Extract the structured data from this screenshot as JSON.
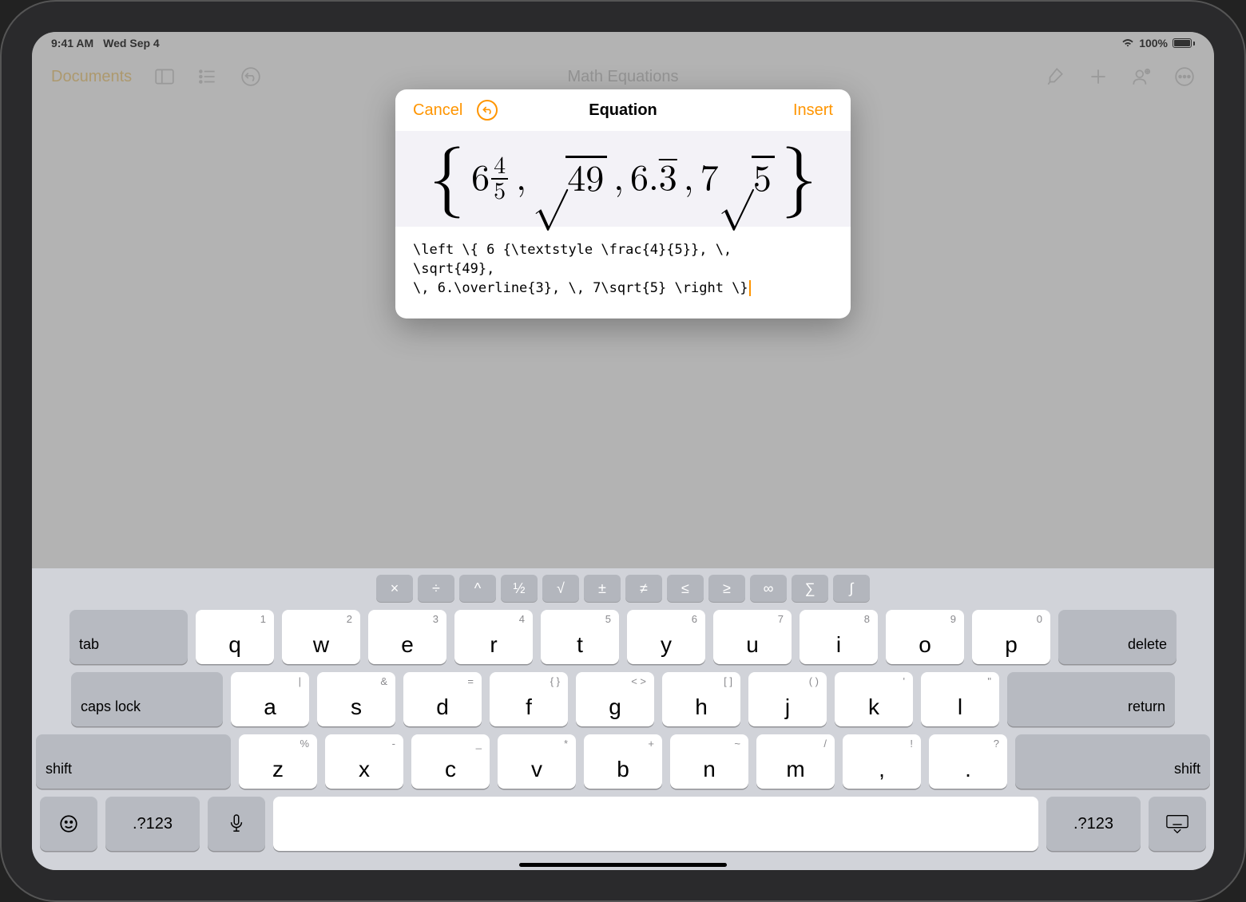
{
  "status": {
    "time": "9:41 AM",
    "date": "Wed Sep 4",
    "battery_pct": "100%"
  },
  "toolbar": {
    "back_label": "Documents",
    "title": "Math Equations"
  },
  "modal": {
    "cancel_label": "Cancel",
    "title": "Equation",
    "insert_label": "Insert",
    "latex_source": "\\left \\{ 6 {\\textstyle \\frac{4}{5}}, \\,\n\\sqrt{49},\n\\, 6.\\overline{3}, \\, 7\\sqrt{5} \\right \\}",
    "preview": {
      "whole": "6",
      "frac_num": "4",
      "frac_den": "5",
      "sqrt1": "49",
      "dec_int": "6.",
      "dec_rep": "3",
      "coef": "7",
      "sqrt2": "5"
    }
  },
  "shortcuts": [
    "×",
    "÷",
    "^",
    "½",
    "√",
    "±",
    "≠",
    "≤",
    "≥",
    "∞",
    "∑",
    "∫"
  ],
  "keyboard": {
    "row1": [
      {
        "main": "q",
        "hint": "1"
      },
      {
        "main": "w",
        "hint": "2"
      },
      {
        "main": "e",
        "hint": "3"
      },
      {
        "main": "r",
        "hint": "4"
      },
      {
        "main": "t",
        "hint": "5"
      },
      {
        "main": "y",
        "hint": "6"
      },
      {
        "main": "u",
        "hint": "7"
      },
      {
        "main": "i",
        "hint": "8"
      },
      {
        "main": "o",
        "hint": "9"
      },
      {
        "main": "p",
        "hint": "0"
      }
    ],
    "row2": [
      {
        "main": "a",
        "hint": "|"
      },
      {
        "main": "s",
        "hint": "&"
      },
      {
        "main": "d",
        "hint": "="
      },
      {
        "main": "f",
        "hint": "{ }"
      },
      {
        "main": "g",
        "hint": "< >"
      },
      {
        "main": "h",
        "hint": "[ ]"
      },
      {
        "main": "j",
        "hint": "( )"
      },
      {
        "main": "k",
        "hint": "'"
      },
      {
        "main": "l",
        "hint": "\""
      }
    ],
    "row3": [
      {
        "main": "z",
        "hint": "%"
      },
      {
        "main": "x",
        "hint": "-"
      },
      {
        "main": "c",
        "hint": "_"
      },
      {
        "main": "v",
        "hint": "*"
      },
      {
        "main": "b",
        "hint": "+"
      },
      {
        "main": "n",
        "hint": "~"
      },
      {
        "main": "m",
        "hint": "/"
      },
      {
        "main": ",",
        "hint": "!"
      },
      {
        "main": ".",
        "hint": "?"
      }
    ],
    "tab": "tab",
    "delete": "delete",
    "caps": "caps lock",
    "return": "return",
    "shift": "shift",
    "symbols": ".?123"
  }
}
